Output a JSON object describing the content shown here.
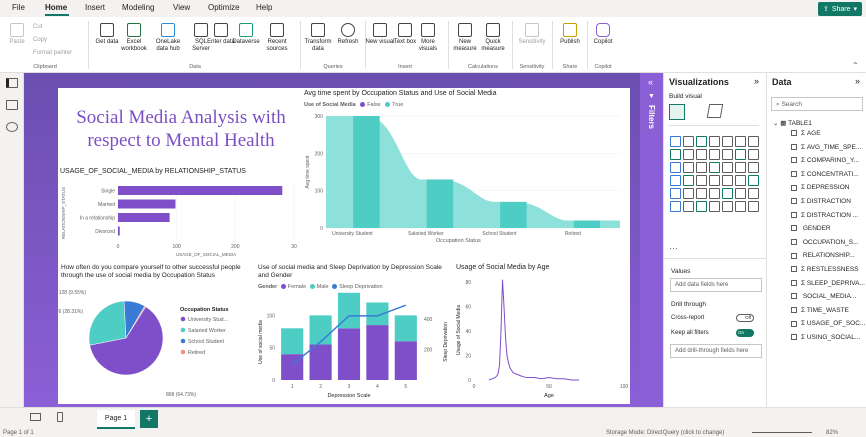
{
  "menu": {
    "file": "File",
    "home": "Home",
    "insert": "Insert",
    "modeling": "Modeling",
    "view": "View",
    "optimize": "Optimize",
    "help": "Help",
    "share": "Share"
  },
  "ribbon": {
    "paste": "Paste",
    "cut": "Cut",
    "copy": "Copy",
    "format_painter": "Format painter",
    "get_data": "Get data",
    "excel": "Excel workbook",
    "onelake": "OneLake data hub",
    "sql": "SQL Server",
    "enter_data": "Enter data",
    "dataverse": "Dataverse",
    "recent": "Recent sources",
    "transform": "Transform data",
    "refresh": "Refresh",
    "new_visual": "New visual",
    "text_box": "Text box",
    "more_visuals": "More visuals",
    "new_measure": "New measure",
    "quick_measure": "Quick measure",
    "sensitivity": "Sensitivity",
    "publish": "Publish",
    "copilot": "Copilot",
    "groups": {
      "clipboard": "Clipboard",
      "data": "Data",
      "queries": "Queries",
      "insert": "Insert",
      "calculations": "Calculations",
      "sensitivity": "Sensitivity",
      "share": "Share",
      "copilot": "Copilot"
    }
  },
  "report": {
    "title": "Social Media Analysis with respect to Mental Health",
    "bar": {
      "title": "USAGE_OF_SOCIAL_MEDIA by RELATIONSHIP_STATUS",
      "ylabel": "RELATIONSHIP_STATUS",
      "xlabel": "USAGE_OF_SOCIAL_MEDIA"
    },
    "area": {
      "title": "Avg time spent by Occupation Status and Use of Social Media",
      "legend_label": "Use of Social Media",
      "ylabel": "Avg time spent",
      "xlabel": "Occupation Status"
    },
    "pie": {
      "title": "How often do you compare yourself to other successful people through the use of social media by Occupation Status",
      "legend_title": "Occupation Status"
    },
    "combo": {
      "title": "Use of social media and Sleep Deprivation by Depression Scale and Gender",
      "legend_label": "Gender",
      "ylabel": "Use of social media",
      "y2label": "Sleep Deprivation",
      "xlabel": "Depression Scale"
    },
    "line": {
      "title": "Usage of Social Media by Age",
      "ylabel": "Usage of Social Media",
      "xlabel": "Age"
    }
  },
  "chart_data": [
    {
      "type": "bar",
      "orientation": "horizontal",
      "categories": [
        "Single",
        "Married",
        "In a relationship",
        "Divorced"
      ],
      "values": [
        280,
        98,
        88,
        3
      ],
      "xlim": [
        0,
        300
      ],
      "xticks": [
        "0",
        "100",
        "200",
        "30"
      ]
    },
    {
      "type": "area",
      "categories": [
        "University Student",
        "Salaried Worker",
        "School Student",
        "Retired"
      ],
      "series": [
        {
          "name": "False",
          "values": [
            300,
            130,
            70,
            20
          ]
        },
        {
          "name": "True",
          "values": [
            300,
            130,
            70,
            20
          ]
        }
      ],
      "yticks": [
        "0",
        "100",
        "200",
        "300"
      ]
    },
    {
      "type": "pie",
      "labels": [
        "University Student",
        "Salaried Worker",
        "School Student",
        "Retired"
      ],
      "values": [
        868,
        376,
        128,
        8
      ],
      "data_labels": [
        "868 (64.73%)",
        "376 (28.31%)",
        "128 (9.55%)",
        ""
      ]
    },
    {
      "type": "bar",
      "categories": [
        "1",
        "2",
        "3",
        "4",
        "5"
      ],
      "series": [
        {
          "name": "Female",
          "values": [
            40,
            55,
            80,
            85,
            60
          ]
        },
        {
          "name": "Male",
          "values": [
            40,
            45,
            55,
            35,
            40
          ]
        },
        {
          "name": "Sleep Deprivation",
          "values": [
            100,
            250,
            420,
            420,
            490
          ]
        }
      ],
      "yticks": [
        "0",
        "50",
        "100"
      ],
      "y2ticks": [
        "200",
        "400"
      ]
    },
    {
      "type": "line",
      "series": [
        {
          "name": "Usage of Social Media",
          "x": [
            10,
            12,
            14,
            15,
            16,
            17,
            18,
            19,
            20,
            21,
            22,
            23,
            24,
            25,
            26,
            28,
            30,
            32,
            35,
            40,
            45,
            50,
            55,
            60,
            65,
            70
          ],
          "y": [
            0,
            1,
            2,
            3,
            5,
            12,
            40,
            82,
            60,
            35,
            20,
            14,
            10,
            8,
            6,
            5,
            4,
            3,
            2,
            2,
            1,
            2,
            1,
            1,
            0,
            0
          ]
        }
      ],
      "xticks": [
        "0",
        "50",
        "100"
      ],
      "yticks": [
        "0",
        "20",
        "40",
        "60",
        "80"
      ]
    }
  ],
  "legend": {
    "false": "False",
    "true": "True",
    "female": "Female",
    "male": "Male",
    "sleep": "Sleep Deprivation",
    "univ": "University Stud...",
    "salaried": "Salaried Worker",
    "school": "School Student",
    "retired": "Retired"
  },
  "colors": {
    "teal": "#4ecdc4",
    "purple": "#7f4fc9",
    "blue": "#3a7bd5",
    "pink": "#f08f80",
    "accent": "#117865"
  },
  "filters": "Filters",
  "viz_pane": {
    "title": "Visualizations",
    "build": "Build visual",
    "values": "Values",
    "add_data": "Add data fields here",
    "drill": "Drill through",
    "cross_report": "Cross-report",
    "cross_state": "Off",
    "keep_filters": "Keep all filters",
    "keep_state": "On",
    "add_drill": "Add drill-through fields here"
  },
  "data_pane": {
    "title": "Data",
    "search": "Search",
    "table": "TABLE1",
    "fields": [
      "AGE",
      "AVG_TIME_SPE...",
      "COMPARING_Y...",
      "CONCENTRATI...",
      "DEPRESSION",
      "DISTRACTION",
      "DISTRACTION ...",
      "GENDER",
      "OCCUPATION_S...",
      "RELATIONSHIP...",
      "RESTLESSNESS",
      "SLEEP_DEPRIVA...",
      "SOCIAL_MEDIA...",
      "TIME_WASTE",
      "USAGE_OF_SOC...",
      "USING_SOCIAL..."
    ]
  },
  "tabs": {
    "page1": "Page 1"
  },
  "status": {
    "page": "Page 1 of 1",
    "storage": "Storage Mode: DirectQuery (click to change)",
    "zoom": "82%"
  }
}
